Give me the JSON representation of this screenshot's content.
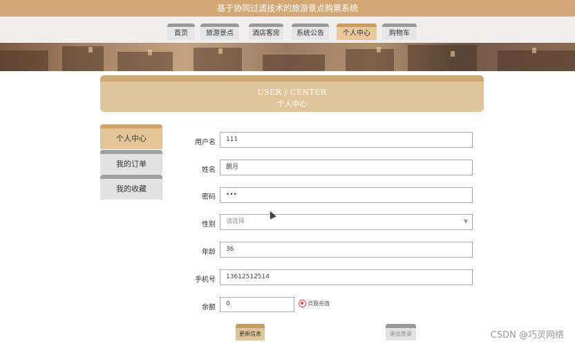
{
  "site": {
    "title": "基于协同过滤技术的旅游景点购票系统"
  },
  "nav": {
    "items": [
      {
        "label": "首页"
      },
      {
        "label": "旅游景点"
      },
      {
        "label": "酒店客房"
      },
      {
        "label": "系统公告"
      },
      {
        "label": "个人中心"
      },
      {
        "label": "购物车"
      }
    ],
    "active": "个人中心"
  },
  "user_center": {
    "title_en": "USER / CENTER",
    "title_cn": "个人中心"
  },
  "sidebar": {
    "items": [
      {
        "label": "个人中心"
      },
      {
        "label": "我的订单"
      },
      {
        "label": "我的收藏"
      }
    ],
    "active": "个人中心"
  },
  "form": {
    "username": {
      "label": "用户名",
      "value": "111"
    },
    "name": {
      "label": "姓名",
      "value": "朗月"
    },
    "password": {
      "label": "密码",
      "value": "•••"
    },
    "gender": {
      "label": "性别",
      "placeholder": "请选择"
    },
    "age": {
      "label": "年龄",
      "value": "36"
    },
    "phone": {
      "label": "手机号",
      "value": "13612512514"
    },
    "balance": {
      "label": "余额",
      "value": "0"
    },
    "recharge_link": "点我充值"
  },
  "buttons": {
    "update": "更新信息",
    "logout": "退出登录"
  },
  "watermark": "CSDN @巧灵网络",
  "colors": {
    "accent": "#d4a874",
    "active_tab": "#e8c89a",
    "recharge_icon": "#e04848"
  }
}
